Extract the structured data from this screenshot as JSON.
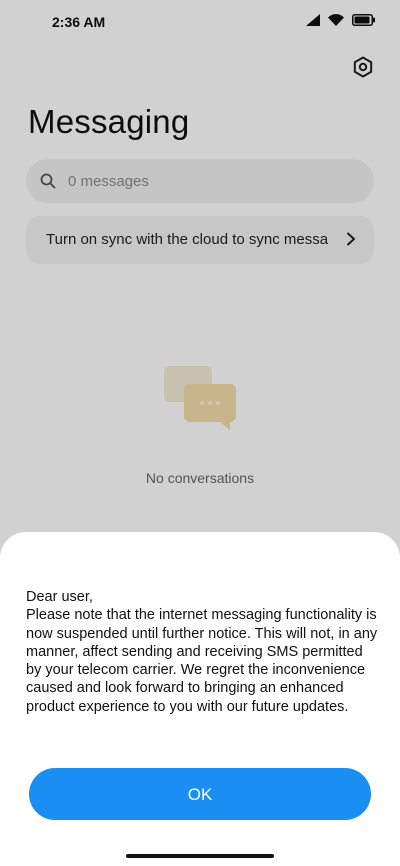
{
  "status_bar": {
    "time": "2:36 AM"
  },
  "header": {
    "title": "Messaging",
    "settings_icon": "gear-icon"
  },
  "search": {
    "placeholder_text": "0 messages",
    "icon": "search-icon"
  },
  "sync_banner": {
    "text": "Turn on sync with the cloud to sync messa"
  },
  "empty_state": {
    "text": "No conversations"
  },
  "dialog": {
    "greeting": "Dear user,",
    "message": "Please note that the internet messaging functionality is now suspended until further notice. This will not, in any manner, affect sending and receiving SMS permitted by your telecom carrier. We regret the inconvenience caused and look forward to bringing an enhanced product experience to you with our future updates.",
    "ok_label": "OK"
  },
  "colors": {
    "accent": "#1b8ef3",
    "sheet_bg": "#ffffff",
    "dim_overlay": "rgba(0,0,0,0.18)"
  }
}
